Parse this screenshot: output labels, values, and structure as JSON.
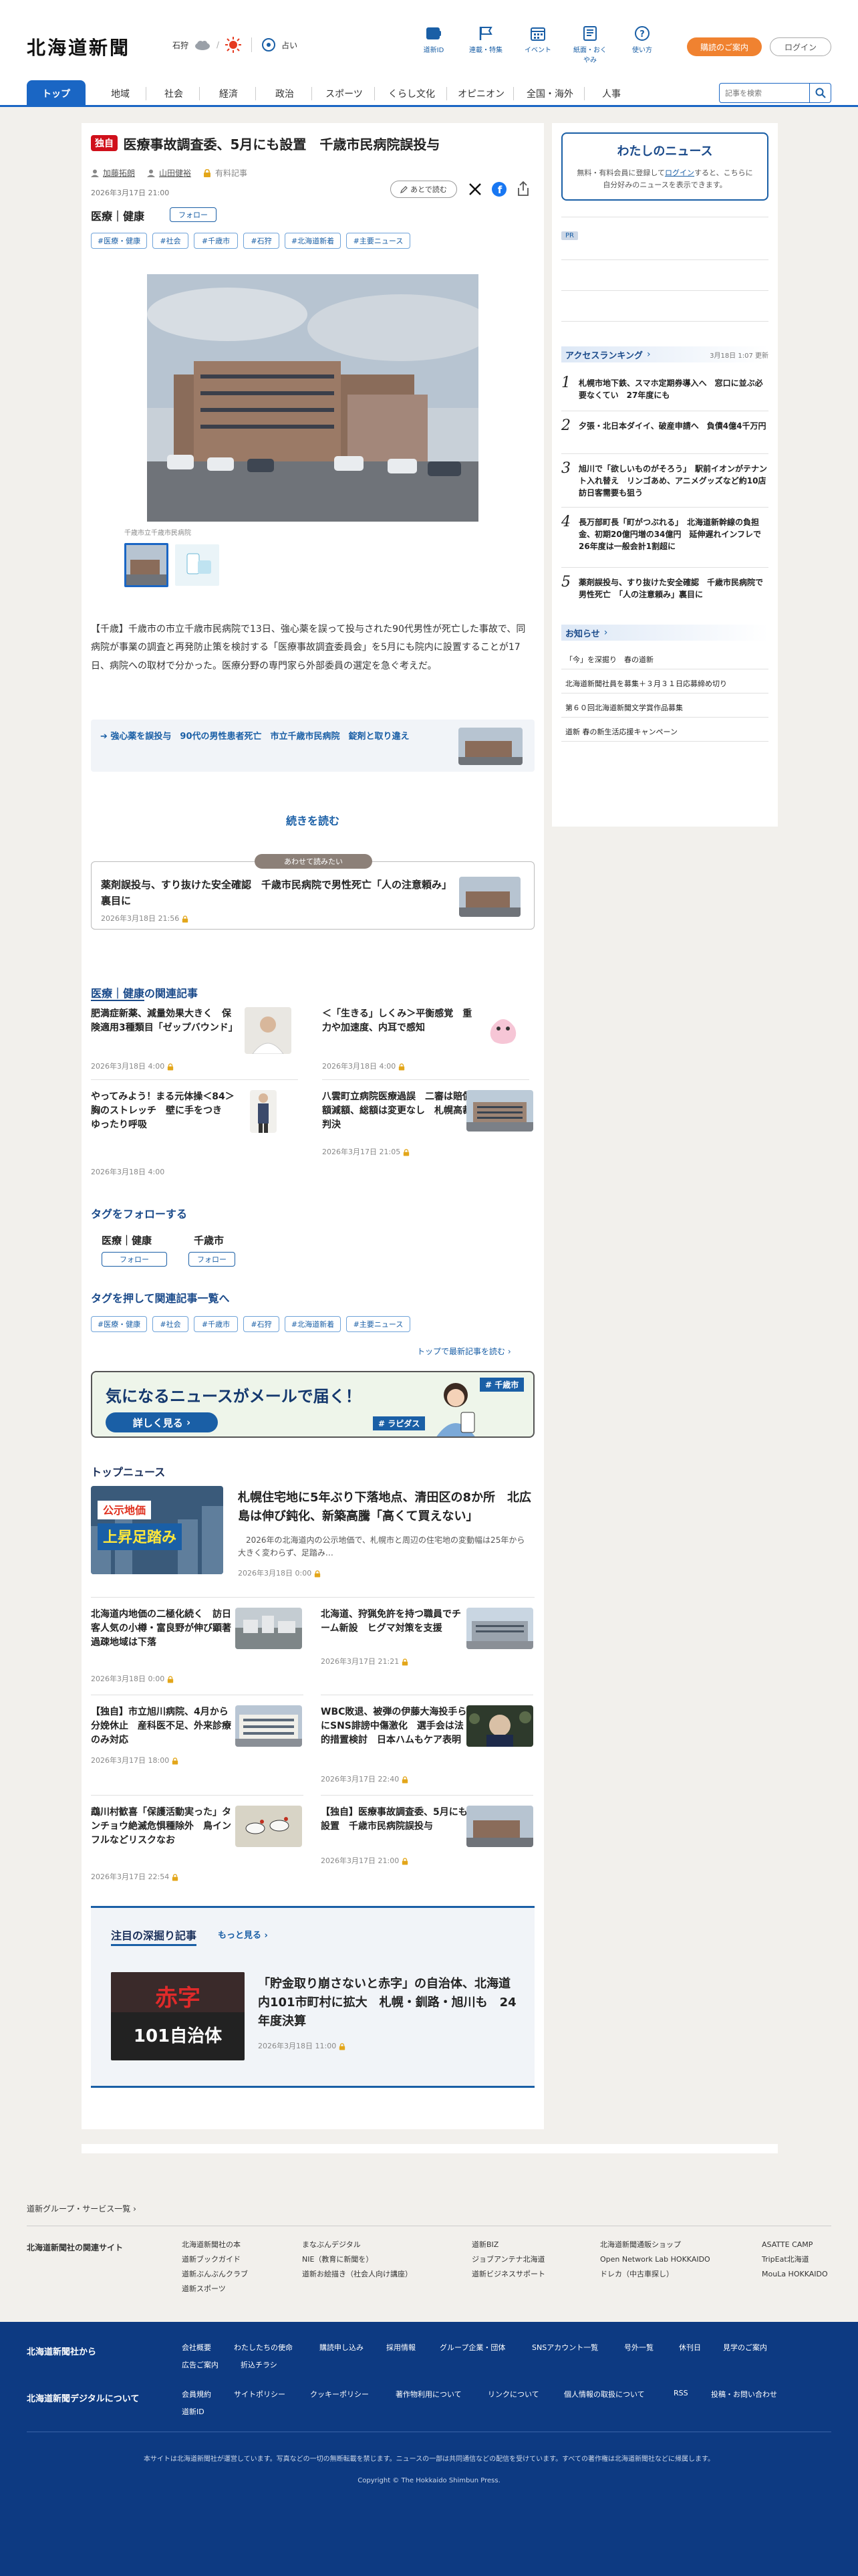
{
  "header": {
    "logo": "北海道新聞",
    "weather": {
      "region": "石狩",
      "temp_label": "占い"
    },
    "nav": [
      {
        "label": "道新ID",
        "icon": "book-icon"
      },
      {
        "label": "連載・特集",
        "icon": "flag-icon"
      },
      {
        "label": "イベント",
        "icon": "calendar-icon"
      },
      {
        "label": "紙面・おくやみ",
        "icon": "newspaper-icon"
      },
      {
        "label": "使い方",
        "icon": "help-icon"
      }
    ],
    "join_label": "購読のご案内",
    "login_label": "ログイン"
  },
  "global_nav": [
    "トップ",
    "地域",
    "社会",
    "経済",
    "政治",
    "スポーツ",
    "くらし文化",
    "オピニオン",
    "全国・海外",
    "人事"
  ],
  "search": {
    "placeholder": "記事を検索"
  },
  "article": {
    "exclusive_badge": "独自",
    "title": "医療事故調査委、5月にも設置　千歳市民病院誤投与",
    "authors": [
      "加藤拓朗",
      "山田健裕"
    ],
    "save_label": "有料記事",
    "date": "2026年3月17日 21:00",
    "later_label": "あとで読む",
    "category": "医療｜健康",
    "follow_label": "フォロー",
    "tags": [
      "#医療・健康",
      "#社会",
      "#千歳市",
      "#石狩",
      "#北海道新着",
      "#主要ニュース"
    ],
    "photo_caption": "千歳市立千歳市民病院",
    "body": "【千歳】千歳市の市立千歳市民病院で13日、強心薬を誤って投与された90代男性が死亡した事故で、同病院が事業の調査と再発防止策を検討する「医療事故調査委員会」を5月にも院内に設置することが17日、病院への取材で分かった。医療分野の専門家ら外部委員の選定を急ぐ考えだ。",
    "related_link": "強心薬を誤投与　90代の男性患者死亡　市立千歳市民病院　錠剤と取り違え",
    "read_more": "続きを読む",
    "also_read_badge": "あわせて読みたい",
    "also_read_title": "薬剤誤投与、すり抜けた安全確認　千歳市民病院で男性死亡「人の注意頼み」裏目に",
    "also_read_date": "2026年3月18日 21:56"
  },
  "related": {
    "title_prefix": "医療｜健康",
    "title_suffix": "の関連記事",
    "items": [
      {
        "title": "肥満症新薬、減量効果大きく　保険適用3種類目「ゼップバウンド」",
        "date": "2026年3月18日 4:00"
      },
      {
        "title": "＜「生きる」しくみ＞平衡感覚　重力や加速度、内耳で感知",
        "date": "2026年3月18日 4:00"
      },
      {
        "title": "やってみよう！まる元体操＜84＞胸のストレッチ　壁に手をつき　ゆったり呼吸",
        "date": "2026年3月18日 4:00"
      },
      {
        "title": "八雲町立病院医療過誤　二審は賠償額減額、総額は変更なし　札幌高裁判決",
        "date": "2026年3月17日 21:05"
      }
    ]
  },
  "follow_tags": {
    "title": "タグをフォローする",
    "items": [
      {
        "name": "医療｜健康",
        "follow": "フォロー"
      },
      {
        "name": "千歳市",
        "follow": "フォロー"
      }
    ]
  },
  "push_tags": {
    "title": "タグを押して関連記事一覧へ",
    "items": [
      "#医療・健康",
      "#社会",
      "#千歳市",
      "#石狩",
      "#北海道新着",
      "#主要ニュース"
    ],
    "more_link": "トップで最新記事を読む"
  },
  "mail_banner": {
    "headline": "気になるニュースがメールで届く！",
    "button": "詳しく見る",
    "tag1": "# 千歳市",
    "tag2": "# ラピダス"
  },
  "top_news": {
    "title": "トップニュース",
    "lead": {
      "title": "札幌住宅地に5年ぶり下落地点、清田区の8か所　北広島は伸び鈍化、新築高騰「高くて買えない」",
      "summary": "2026年の北海道内の公示地価で、札幌市と周辺の住宅地の変動幅は25年から大きく変わらず、足踏み…",
      "date": "2026年3月18日 0:00",
      "thumb_text1": "公示地価",
      "thumb_text2": "上昇足踏み"
    },
    "items": [
      {
        "title": "北海道内地価の二極化続く　訪日客人気の小樽・富良野が伸び顕著　過疎地域は下落",
        "date": "2026年3月18日 0:00"
      },
      {
        "title": "北海道、狩猟免許を持つ職員でチーム新設　ヒグマ対策を支援",
        "date": "2026年3月17日 21:21"
      },
      {
        "title": "【独自】市立旭川病院、4月から分娩休止　産科医不足、外来診療のみ対応",
        "date": "2026年3月17日 18:00"
      },
      {
        "title": "WBC敗退、被弾の伊藤大海投手らにSNS誹謗中傷激化　選手会は法的措置検討　日本ハムもケア表明",
        "date": "2026年3月17日 22:40"
      },
      {
        "title": "鵡川村歓喜「保護活動実った」タンチョウ絶滅危惧種除外　鳥インフルなどリスクなお",
        "date": "2026年3月17日 22:54"
      },
      {
        "title": "【独自】医療事故調査委、5月にも設置　千歳市民病院誤投与",
        "date": "2026年3月17日 21:00"
      }
    ]
  },
  "deep_dive": {
    "title": "注目の深掘り記事",
    "more": "もっと見る",
    "thumb_text1": "赤字",
    "thumb_text2": "101自治体",
    "article_title": "「貯金取り崩さないと赤字」の自治体、北海道内101市町村に拡大　札幌・釧路・旭川も　24年度決算",
    "date": "2026年3月18日 11:00"
  },
  "sidebar": {
    "my_news_title": "わたしのニュース",
    "my_news_text_pre": "無料・有料会員に登録して",
    "my_news_link": "ログイン",
    "my_news_text_post": "すると、こちらに自分好みのニュースを表示できます。",
    "pr_label": "PR",
    "ranking_title": "アクセスランキング",
    "ranking_date": "3月18日 1:07 更新",
    "ranking": [
      "札幌市地下鉄、スマホ定期券導入へ　窓口に並ぶ必要なくてい　27年度にも",
      "夕張・北日本ダイイ、破産申請へ　負債4億4千万円",
      "旭川で「欲しいものがそろう」　駅前イオンがテナント入れ替え　リンゴあめ、アニメグッズなど約10店　訪日客需要も狙う",
      "長万部町長「町がつぶれる」　北海道新幹線の負担金、初期20億円増の34億円　延伸遅れインフレで　26年度は一般会計1割超に",
      "薬剤誤投与、すり抜けた安全確認　千歳市民病院で男性死亡　「人の注意頼み」裏目に"
    ],
    "notice_title": "お知らせ",
    "notices": [
      "「今」を深掘り　春の道新",
      "北海道新聞社員を募集＋３月３１日応募締め切り",
      "第６０回北海道新聞文学賞作品募集",
      "道新 春の新生活応援キャンペーン"
    ]
  },
  "footer": {
    "group_label": "道新グループ・サービス一覧",
    "related_label": "北海道新聞社の関連サイト",
    "cols": [
      [
        "北海道新聞社の本",
        "道新ブックガイド",
        "道新ぶんぶんクラブ",
        "道新スポーツ"
      ],
      [
        "まなぶんデジタル",
        "NIE（教育に新聞を）",
        "道新お絵描き（社会人向け講座）"
      ],
      [
        "道新BIZ",
        "ジョブアンテナ北海道",
        "道新ビジネスサポート"
      ],
      [
        "北海道新聞通販ショップ",
        "Open Network Lab HOKKAIDO",
        "ドレカ（中古車探し）"
      ],
      [
        "ASATTE CAMP",
        "TripEat北海道",
        "MouLa HOKKAIDO"
      ]
    ],
    "from_label": "北海道新聞社から",
    "from_links": [
      "会社概要",
      "わたしたちの使命",
      "購読申し込み",
      "採用情報",
      "グループ企業・団体",
      "SNSアカウント一覧",
      "号外一覧",
      "休刊日",
      "見学のご案内",
      "広告ご案内",
      "折込チラシ"
    ],
    "digital_label": "北海道新聞デジタルについて",
    "digital_links": [
      "会員規約",
      "サイトポリシー",
      "クッキーポリシー",
      "著作物利用について",
      "リンクについて",
      "個人情報の取扱について",
      "RSS",
      "投稿・お問い合わせ",
      "道新ID"
    ],
    "copyright_note": "本サイトは北海道新聞社が運営しています。写真などの一切の無断転載を禁じます。ニュースの一部は共同通信などの配信を受けています。すべての著作権は北海道新聞社などに帰属します。",
    "copyright": "Copyright © The Hokkaido Shimbun Press."
  },
  "colors": {
    "brand_blue": "#1a66c4",
    "footer_navy": "#0d3a82",
    "accent_orange": "#f08230",
    "exclusive_red": "#d0101b"
  }
}
